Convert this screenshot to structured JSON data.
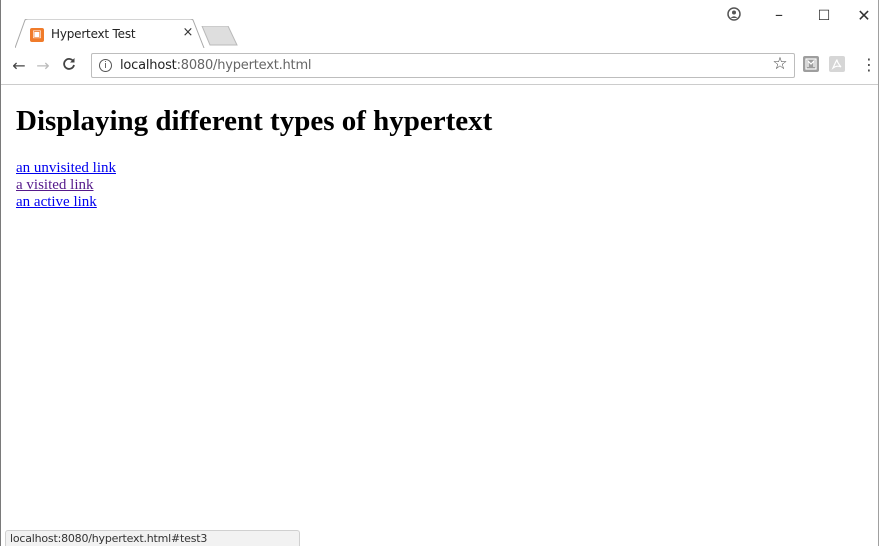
{
  "tab": {
    "title": "Hypertext Test",
    "close_glyph": "×",
    "favicon": "xampp-icon"
  },
  "window_controls": {
    "profile": "⊖",
    "minimize": "–",
    "maximize": "☐",
    "close": "✕"
  },
  "toolbar": {
    "back_glyph": "←",
    "forward_glyph": "→",
    "reload_glyph": "C",
    "url_host": "localhost",
    "url_rest": ":8080/hypertext.html",
    "info_glyph": "i",
    "star_glyph": "☆",
    "menu_glyph": "⋮"
  },
  "page": {
    "heading": "Displaying different types of hypertext",
    "links": [
      {
        "label": "an unvisited link",
        "color": "#0000ee"
      },
      {
        "label": "a visited link",
        "color": "#551a8b"
      },
      {
        "label": "an active link",
        "color": "#0000ee"
      }
    ]
  },
  "status_bar": {
    "text": "localhost:8080/hypertext.html#test3"
  },
  "colors": {
    "favicon": "#f07b2a",
    "toolbar_border": "#cccccc"
  }
}
